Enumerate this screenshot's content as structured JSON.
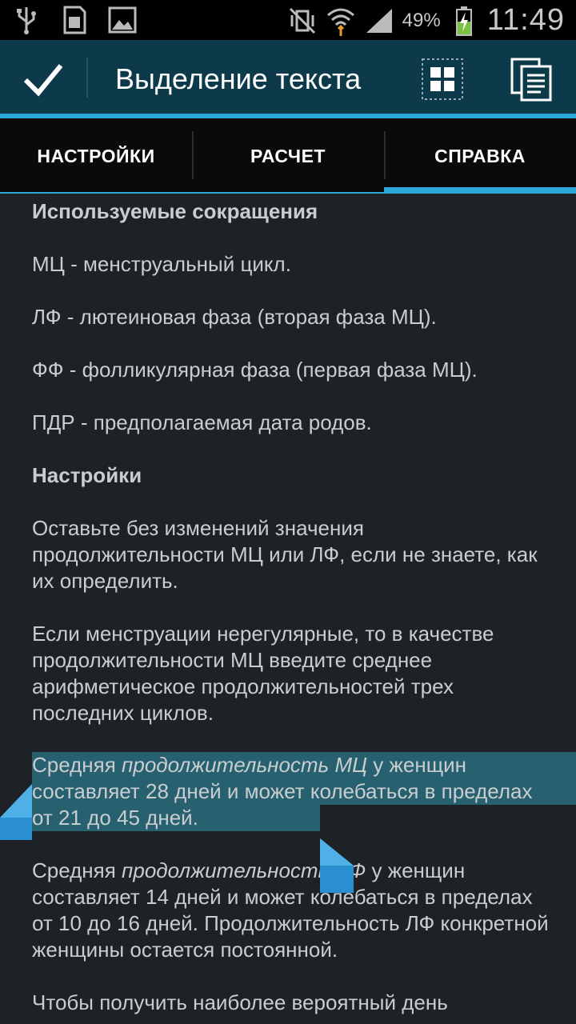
{
  "statusbar": {
    "battery_pct": "49%",
    "time": "11:49"
  },
  "actionbar": {
    "title": "Выделение текста"
  },
  "tabs": [
    {
      "label": "НАСТРОЙКИ",
      "active": false
    },
    {
      "label": "РАСЧЕТ",
      "active": false
    },
    {
      "label": "СПРАВКА",
      "active": true
    }
  ],
  "content": {
    "h1": "Используемые сокращения",
    "p1": "МЦ - менструальный цикл.",
    "p2": "ЛФ - лютеиновая фаза (вторая фаза МЦ).",
    "p3": "ФФ - фолликулярная фаза (первая фаза МЦ).",
    "p4": "ПДР - предполагаемая дата родов.",
    "h2": "Настройки",
    "p5": "Оставьте без изменений значения продолжительности МЦ или ЛФ, если не знаете, как их определить.",
    "p6": "Если менструации нерегулярные, то в качестве продолжительности МЦ введите среднее арифметическое продолжительностей трех последних циклов.",
    "p7_a": "Средняя ",
    "p7_i": "продолжительность МЦ",
    "p7_b": " у женщин составляет 28 дней и может колебаться в пределах от 21 до 45 дней.",
    "p8_a": "Средняя ",
    "p8_i": "продолжительность ЛФ",
    "p8_b": " у женщин составляет 14 дней и может колебаться в пределах от 10 до 16 дней. Продолжительность ЛФ конкретной женщины остается постоянной.",
    "p9": "Чтобы получить наиболее вероятный день"
  },
  "colors": {
    "accent": "#2aa8d8",
    "actionbar_bg": "#0d3a4a",
    "selection_bg": "#27606f",
    "content_bg": "#1e2226"
  }
}
